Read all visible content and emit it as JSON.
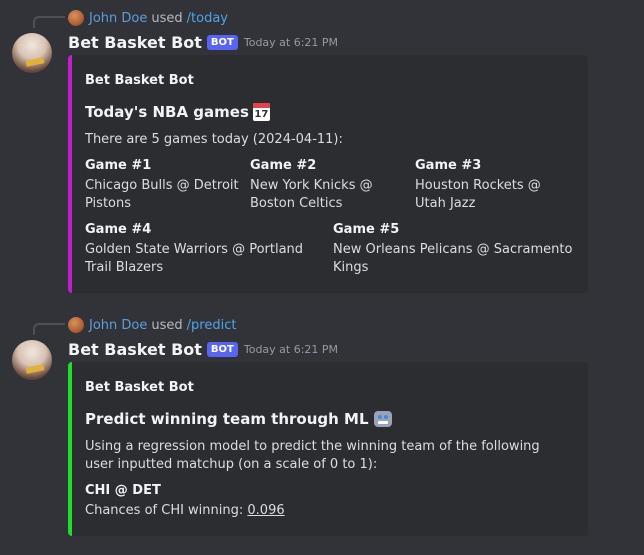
{
  "messages": [
    {
      "reply": {
        "user": "John Doe",
        "used": "used",
        "command": "/today"
      },
      "author": {
        "name": "Bet Basket Bot",
        "badge": "BOT",
        "timestamp": "Today at 6:21 PM"
      },
      "embed": {
        "color": "#c21ecf",
        "author": "Bet Basket Bot",
        "title": "Today's NBA games",
        "title_icon": "calendar-icon",
        "calendar_day": "17",
        "description": "There are 5 games today (2024-04-11):",
        "fields": [
          {
            "name": "Game #1",
            "value": "Chicago Bulls @ Detroit Pistons"
          },
          {
            "name": "Game #2",
            "value": "New York Knicks @ Boston Celtics"
          },
          {
            "name": "Game #3",
            "value": "Houston Rockets @ Utah Jazz"
          },
          {
            "name": "Game #4",
            "value": "Golden State Warriors @ Portland Trail Blazers"
          },
          {
            "name": "Game #5",
            "value": "New Orleans Pelicans @ Sacramento Kings"
          }
        ]
      }
    },
    {
      "reply": {
        "user": "John Doe",
        "used": "used",
        "command": "/predict"
      },
      "author": {
        "name": "Bet Basket Bot",
        "badge": "BOT",
        "timestamp": "Today at 6:21 PM"
      },
      "embed": {
        "color": "#1fdd2a",
        "author": "Bet Basket Bot",
        "title": "Predict winning team through ML",
        "title_icon": "robot-icon",
        "description": "Using a regression model to predict the winning team of the following user inputted matchup (on a scale of 0 to 1):",
        "fields": [
          {
            "name": "CHI @ DET",
            "value_prefix": "Chances of CHI winning: ",
            "value_link": "0.096"
          }
        ]
      }
    }
  ]
}
